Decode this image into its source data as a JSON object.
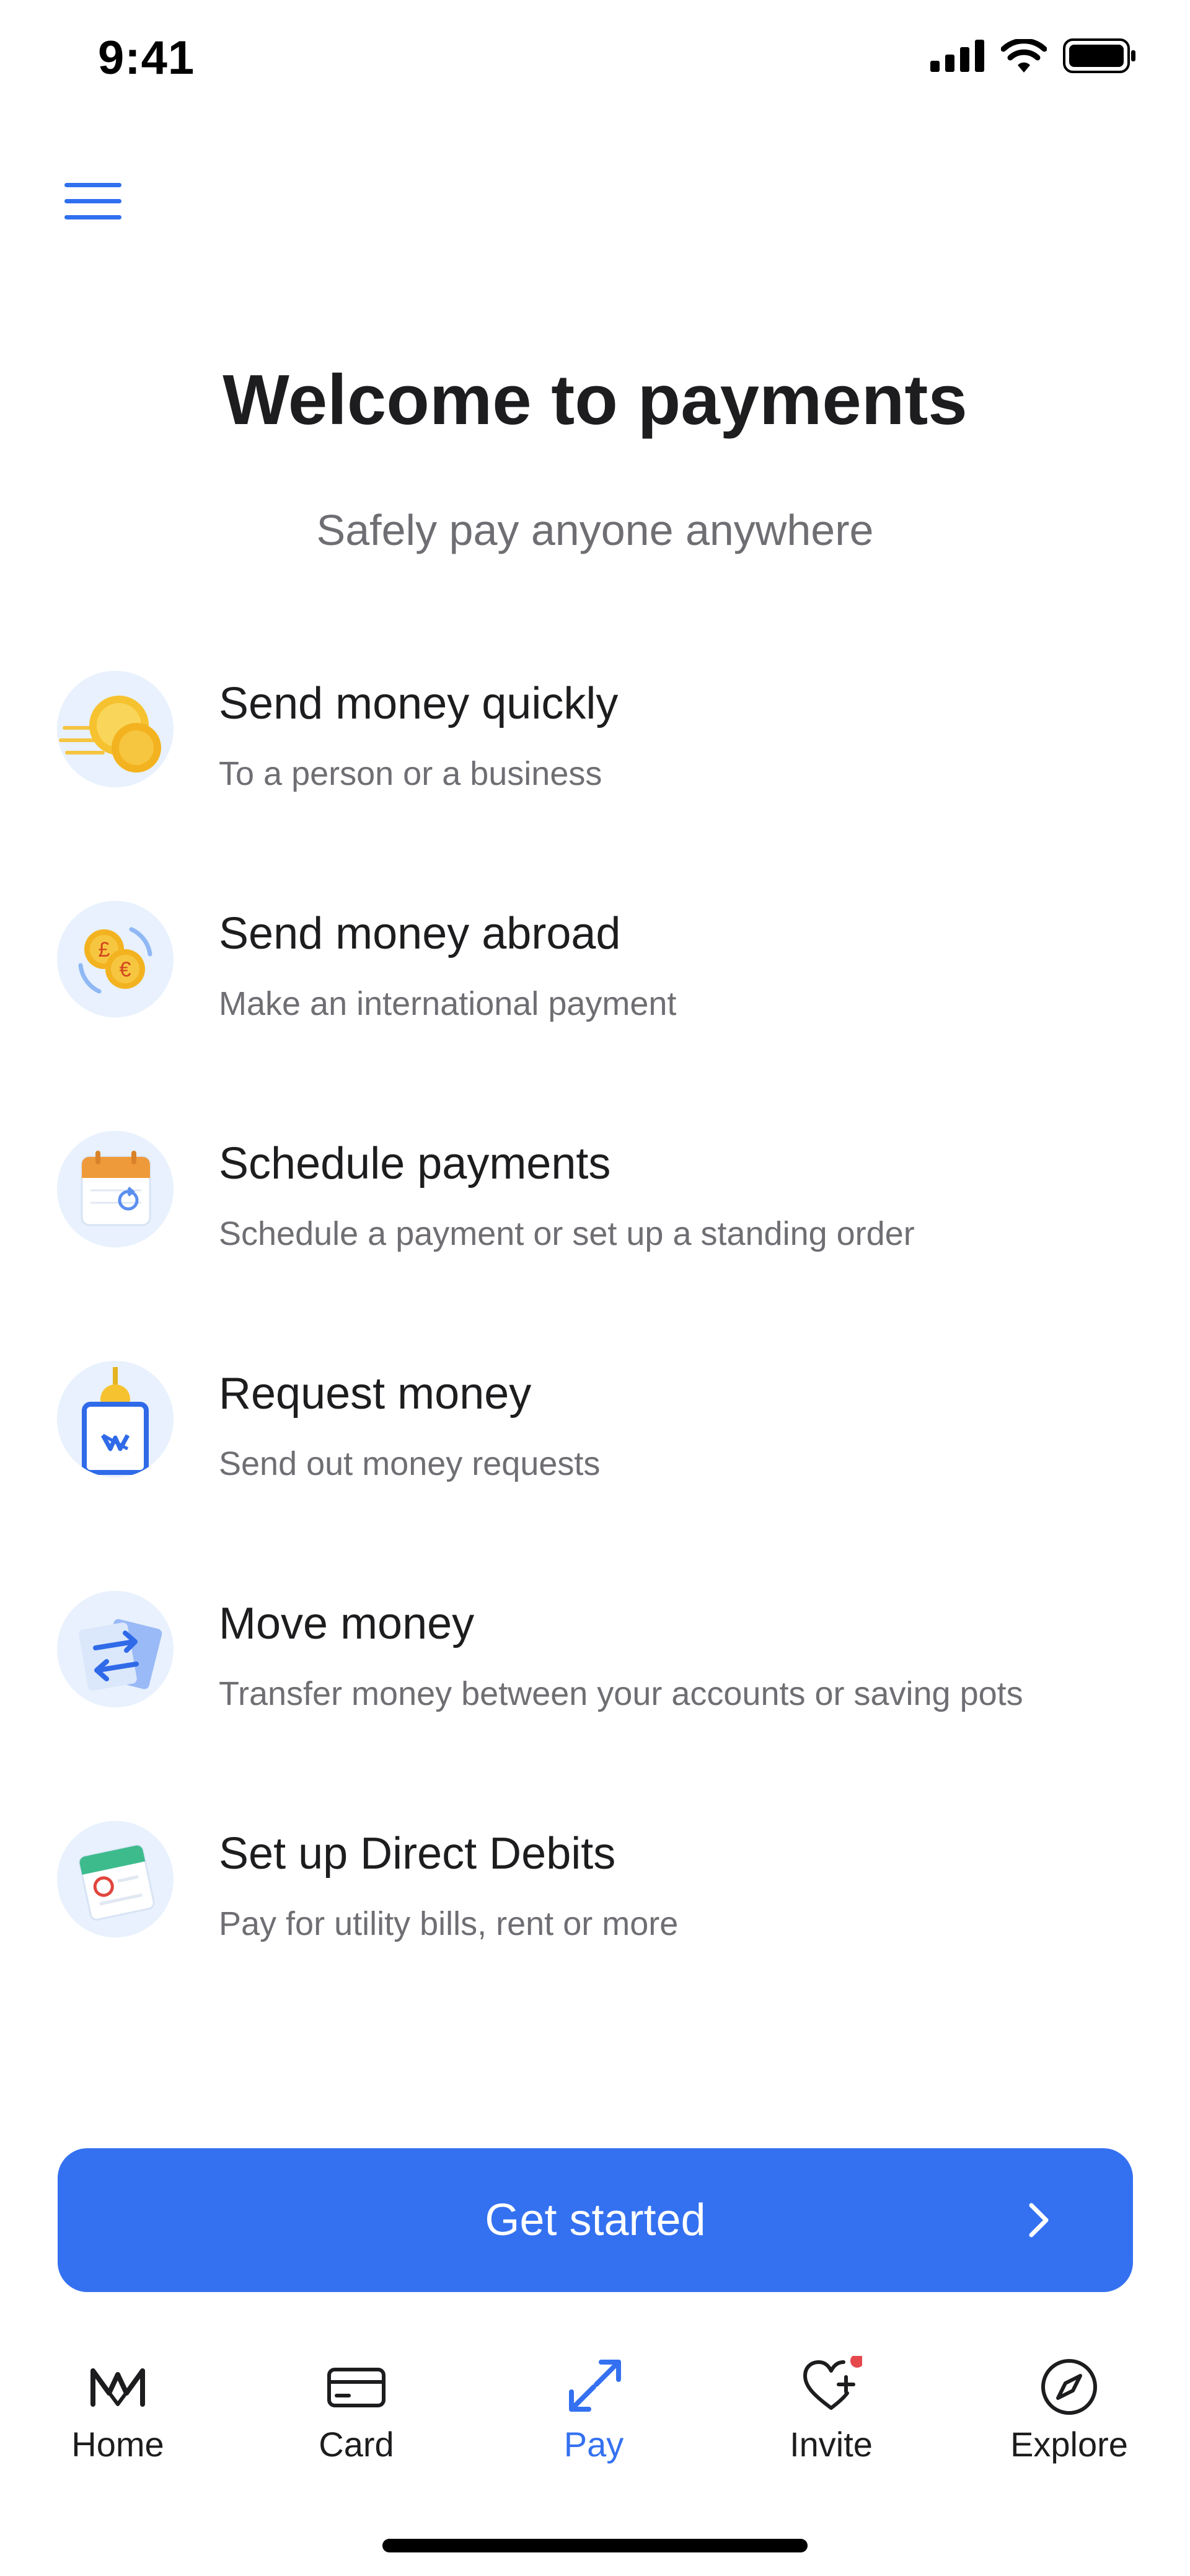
{
  "status_bar": {
    "time": "9:41"
  },
  "header": {
    "menu_icon": "hamburger-menu-icon",
    "title": "Welcome to payments",
    "subtitle": "Safely pay anyone anywhere"
  },
  "features": [
    {
      "title": "Send money quickly",
      "description": "To a person or a business",
      "icon": "coins-fast-icon"
    },
    {
      "title": "Send money abroad",
      "description": "Make an international payment",
      "icon": "currency-exchange-icon"
    },
    {
      "title": "Schedule payments",
      "description": "Schedule a payment or set up a standing order",
      "icon": "calendar-icon"
    },
    {
      "title": "Request money",
      "description": "Send out money requests",
      "icon": "request-money-icon"
    },
    {
      "title": "Move money",
      "description": "Transfer money between your accounts or saving pots",
      "icon": "transfer-arrows-icon"
    },
    {
      "title": "Set up Direct Debits",
      "description": "Pay for utility bills, rent or more",
      "icon": "direct-debit-icon"
    }
  ],
  "cta": {
    "label": "Get started",
    "icon": "chevron-right-icon"
  },
  "tabs": [
    {
      "label": "Home",
      "icon": "home-logo-icon",
      "active": false
    },
    {
      "label": "Card",
      "icon": "card-icon",
      "active": false
    },
    {
      "label": "Pay",
      "icon": "pay-arrows-icon",
      "active": true
    },
    {
      "label": "Invite",
      "icon": "heart-plus-icon",
      "active": false
    },
    {
      "label": "Explore",
      "icon": "compass-icon",
      "active": false
    }
  ],
  "colors": {
    "accent": "#3471f1",
    "text_primary": "#1d1d1f",
    "text_secondary": "#6e6e73",
    "icon_background": "#e8f1fd",
    "notification_dot": "#e5484d"
  }
}
